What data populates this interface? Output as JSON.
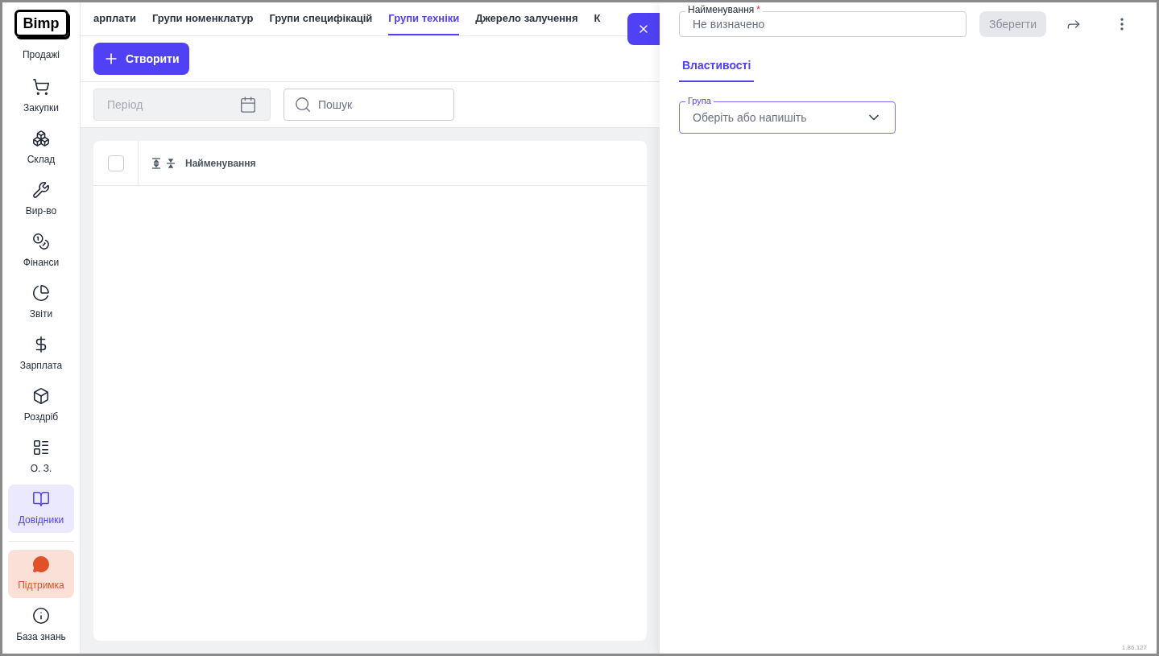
{
  "sidebar": {
    "logo": "Bimp",
    "items": [
      {
        "label": "Продажі",
        "kind": "nav",
        "selected": false
      },
      {
        "label": "Закупки",
        "kind": "nav",
        "selected": false
      },
      {
        "label": "Склад",
        "kind": "nav",
        "selected": false
      },
      {
        "label": "Вир-во",
        "kind": "nav",
        "selected": false
      },
      {
        "label": "Фінанси",
        "kind": "nav",
        "selected": false
      },
      {
        "label": "Звіти",
        "kind": "nav",
        "selected": false
      },
      {
        "label": "Зарплата",
        "kind": "nav",
        "selected": false
      },
      {
        "label": "Роздріб",
        "kind": "nav",
        "selected": false
      },
      {
        "label": "О. З.",
        "kind": "nav",
        "selected": false
      },
      {
        "label": "Довідники",
        "kind": "nav",
        "selected": true
      },
      {
        "label": "Підтримка",
        "kind": "support",
        "selected": false
      },
      {
        "label": "База знань",
        "kind": "nav",
        "selected": false
      }
    ]
  },
  "tabs": [
    {
      "label": "арплати",
      "selected": false
    },
    {
      "label": "Групи номенклатур",
      "selected": false
    },
    {
      "label": "Групи специфікацій",
      "selected": false
    },
    {
      "label": "Групи техніки",
      "selected": true
    },
    {
      "label": "Джерело залучення",
      "selected": false
    },
    {
      "label": "К",
      "selected": false
    }
  ],
  "create_button": "Створити",
  "filters": {
    "period": {
      "placeholder": "Період"
    },
    "search": {
      "placeholder": "Пошук"
    }
  },
  "table": {
    "select_all": {
      "checked": false
    },
    "columns": [
      "Найменування"
    ]
  },
  "drawer": {
    "name_field": {
      "label": "Найменування",
      "required_mark": "*",
      "placeholder": "Не визначено"
    },
    "save_button": {
      "label": "Зберегти",
      "disabled": true
    },
    "tabs": [
      {
        "label": "Властивості",
        "selected": true
      }
    ],
    "group_field": {
      "label": "Група",
      "placeholder": "Оберіть або напишіть"
    },
    "version": "1.86.127"
  }
}
